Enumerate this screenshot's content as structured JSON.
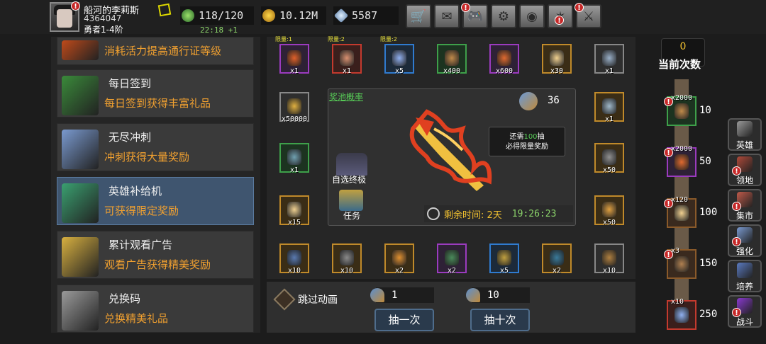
{
  "player": {
    "name": "船河的李莉斯",
    "id": "4364047",
    "rank": "勇者1-4阶"
  },
  "resources": {
    "energy": "118/120",
    "energy_timer": "22:18 +1",
    "gold": "10.12M",
    "gems": "5587"
  },
  "toolbar": [
    {
      "name": "shop-cart-button",
      "glyph": "🛒"
    },
    {
      "name": "mail-button",
      "glyph": "✉"
    },
    {
      "name": "gamepad-button",
      "glyph": "🎮"
    },
    {
      "name": "settings-button",
      "glyph": "⚙"
    },
    {
      "name": "color-wheel-button",
      "glyph": "◉"
    },
    {
      "name": "firework-button",
      "glyph": "✶"
    },
    {
      "name": "swords-button",
      "glyph": "⚔"
    }
  ],
  "menu": [
    {
      "title": "",
      "sub": "消耗活力提高通行证等级",
      "color": "#c04a1a"
    },
    {
      "title": "每日签到",
      "sub": "每日签到获得丰富礼品",
      "color": "#3a8a3a"
    },
    {
      "title": "无尽冲刺",
      "sub": "冲刺获得大量奖励",
      "color": "#7a9ad0"
    },
    {
      "title": "英雄补给机",
      "sub": "可获得限定奖励",
      "color": "#3aa070"
    },
    {
      "title": "累计观看广告",
      "sub": "观看广告获得精美奖励",
      "color": "#d8b040"
    },
    {
      "title": "兑换码",
      "sub": "兑换精美礼品",
      "color": "#9a9a9a"
    }
  ],
  "top_row": [
    {
      "limit": "限量:1",
      "count": "x1",
      "color": "#e0602a"
    },
    {
      "limit": "限量:2",
      "count": "x1",
      "color": "#d89070"
    },
    {
      "limit": "限量:2",
      "count": "x5",
      "color": "#90b0f0"
    },
    {
      "limit": "",
      "count": "x400",
      "color": "#c08a4a"
    },
    {
      "limit": "",
      "count": "x600",
      "color": "#e06a30"
    },
    {
      "limit": "",
      "count": "x30",
      "color": "#f0d090"
    },
    {
      "limit": "",
      "count": "x1",
      "color": "#9ab0c8"
    }
  ],
  "left_col": [
    {
      "count": "x50000",
      "color": "#e0b040"
    },
    {
      "count": "x1",
      "color": "#70a0b0"
    },
    {
      "count": "x15",
      "color": "#f0d090"
    }
  ],
  "right_col": [
    {
      "count": "x1",
      "color": "#a0b8c8"
    },
    {
      "count": "x50",
      "color": "#909090"
    },
    {
      "count": "x50",
      "color": "#e0a040"
    }
  ],
  "bottom_row": [
    {
      "count": "x10",
      "color": "#5a7ab0"
    },
    {
      "count": "x10",
      "color": "#8a8a8a"
    },
    {
      "count": "x2",
      "color": "#e09030"
    },
    {
      "count": "x2",
      "color": "#4a8a5a"
    },
    {
      "count": "x5",
      "color": "#c0a040"
    },
    {
      "count": "x2",
      "color": "#3a7a9a"
    },
    {
      "count": "x10",
      "color": "#b08040"
    }
  ],
  "pool": {
    "label": "奖池概率",
    "key_count": "36",
    "tip_pre": "还需",
    "tip_num": "100",
    "tip_post": "抽",
    "tip_line2": "必得限量奖励",
    "auto_label": "自选终极",
    "task_label": "任务",
    "time_label": "剩余时间: 2天",
    "time_value": "19:26:23"
  },
  "bottom": {
    "skip_label": "跳过动画",
    "single_cost": "1",
    "ten_cost": "10",
    "single_label": "抽一次",
    "ten_label": "抽十次"
  },
  "counter": {
    "value": "0",
    "label": "当前次数"
  },
  "milestones": [
    {
      "count": "x2000",
      "target": "10",
      "color": "#c08a4a"
    },
    {
      "count": "x2000",
      "target": "50",
      "color": "#e06a30"
    },
    {
      "count": "x120",
      "target": "100",
      "color": "#f0d090"
    },
    {
      "count": "x3",
      "target": "150",
      "color": "#b08050"
    },
    {
      "count": "x10",
      "target": "250",
      "color": "#90b0f0"
    }
  ],
  "nav": [
    {
      "label": "英雄",
      "color": "#9a9a9a"
    },
    {
      "label": "领地",
      "color": "#b04a3a"
    },
    {
      "label": "集市",
      "color": "#c05a4a"
    },
    {
      "label": "强化",
      "color": "#7a9ad0"
    },
    {
      "label": "培养",
      "color": "#5a7ac0"
    },
    {
      "label": "战斗",
      "color": "#8a3ad0"
    }
  ]
}
